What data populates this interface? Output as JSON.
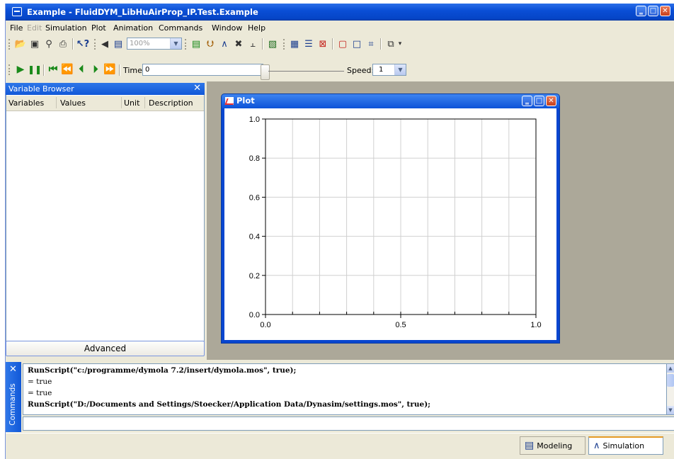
{
  "window": {
    "title": "Example - FluidDYM_LibHuAirProp_IP.Test.Example",
    "minimize_glyph": "‗",
    "restore_glyph": "□",
    "close_glyph": "✕"
  },
  "menu": {
    "items": [
      {
        "label": "File",
        "enabled": true
      },
      {
        "label": "Edit",
        "enabled": false
      },
      {
        "label": "Simulation",
        "enabled": true
      },
      {
        "label": "Plot",
        "enabled": true
      },
      {
        "label": "Animation",
        "enabled": true
      },
      {
        "label": "Commands",
        "enabled": true
      },
      {
        "label": "Window",
        "enabled": true
      },
      {
        "label": "Help",
        "enabled": true
      }
    ]
  },
  "toolbar": {
    "zoom_value": "100%",
    "time_label": "Time:",
    "time_value": "0",
    "speed_label": "Speed:",
    "speed_value": "1",
    "dropdown_glyph": "▼"
  },
  "variable_browser": {
    "title": "Variable Browser",
    "close_glyph": "✕",
    "columns": [
      "Variables",
      "Values",
      "Unit",
      "Description"
    ],
    "advanced_label": "Advanced"
  },
  "plot_window": {
    "title": "Plot"
  },
  "chart_data": {
    "type": "line",
    "series": [],
    "xlim": [
      0.0,
      1.0
    ],
    "ylim": [
      0.0,
      1.0
    ],
    "x_ticks": [
      "0.0",
      "0.5",
      "1.0"
    ],
    "y_ticks": [
      "0.0",
      "0.2",
      "0.4",
      "0.6",
      "0.8",
      "1.0"
    ],
    "x_ticks_values": [
      0.0,
      0.5,
      1.0
    ],
    "y_ticks_values": [
      0.0,
      0.2,
      0.4,
      0.6,
      0.8,
      1.0
    ],
    "x_grid_divisions": 10,
    "grid": true,
    "title": "",
    "xlabel": "",
    "ylabel": ""
  },
  "commands": {
    "tab_label": "Commands",
    "close_glyph": "✕",
    "log": [
      {
        "text": "RunScript(\"c:/programme/dymola 7.2/insert/dymola.mos\", true);",
        "bold": true
      },
      {
        "text": " = true",
        "bold": false
      },
      {
        "text": " = true",
        "bold": false
      },
      {
        "text": "RunScript(\"D:/Documents and Settings/Stoecker/Application Data/Dynasim/settings.mos\", true);",
        "bold": true
      }
    ],
    "scroll_up_glyph": "▲",
    "scroll_down_glyph": "▼"
  },
  "mode_tabs": {
    "modeling_label": "Modeling",
    "simulation_label": "Simulation",
    "active": "Simulation"
  },
  "colors": {
    "title_bar": "#0a4fd6",
    "window_face": "#ece9d8",
    "mdi_background": "#aca899",
    "play_green": "#1a8a1a"
  }
}
